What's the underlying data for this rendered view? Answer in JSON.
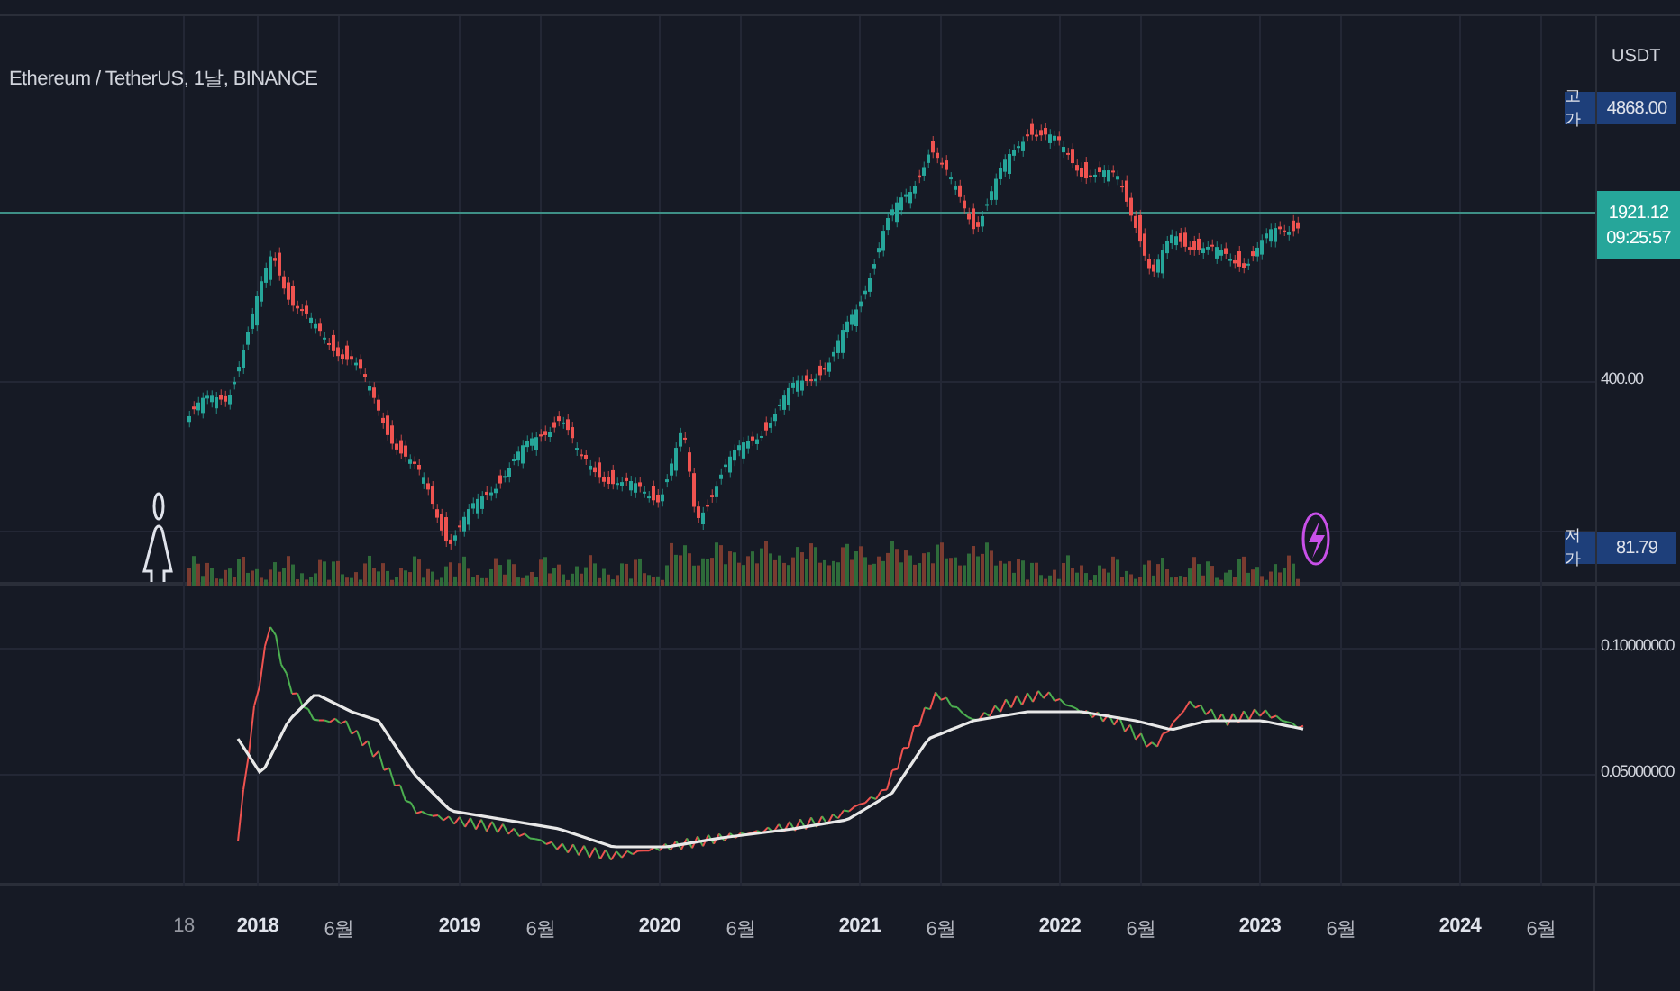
{
  "chart": {
    "title": "Ethereum / TetherUS, 1날, BINANCE"
  },
  "price_axis": {
    "currency": "USDT",
    "ticks": [
      "400.00"
    ],
    "high_marker": {
      "tag": "고가",
      "value": "4868.00"
    },
    "last_price": {
      "price": "1921.12",
      "countdown": "09:25:57"
    },
    "low_marker": {
      "tag": "저가",
      "value": "81.79"
    }
  },
  "indicator_axis": {
    "ticks": [
      "0.10000000",
      "0.05000000"
    ]
  },
  "time_axis": [
    {
      "label": "18",
      "kind": "partial"
    },
    {
      "label": "2018",
      "kind": "year"
    },
    {
      "label": "6월",
      "kind": "month"
    },
    {
      "label": "2019",
      "kind": "year"
    },
    {
      "label": "6월",
      "kind": "month"
    },
    {
      "label": "2020",
      "kind": "year"
    },
    {
      "label": "6월",
      "kind": "month"
    },
    {
      "label": "2021",
      "kind": "year"
    },
    {
      "label": "6월",
      "kind": "month"
    },
    {
      "label": "2022",
      "kind": "year"
    },
    {
      "label": "6월",
      "kind": "month"
    },
    {
      "label": "2023",
      "kind": "year"
    },
    {
      "label": "6월",
      "kind": "month"
    },
    {
      "label": "2024",
      "kind": "year"
    },
    {
      "label": "6월",
      "kind": "month"
    }
  ]
}
